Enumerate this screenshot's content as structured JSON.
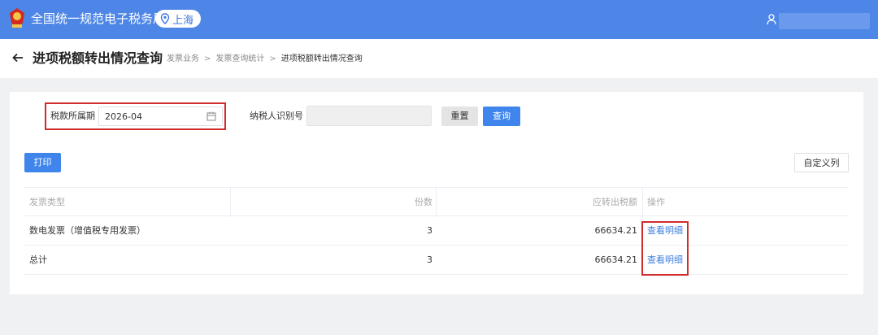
{
  "app": {
    "title": "全国统一规范电子税务局",
    "region": "上海",
    "emblem_color": "#d5281e",
    "accent": "#4d86e6"
  },
  "header": {
    "title": "进项税额转出情况查询",
    "breadcrumb": [
      "发票业务",
      "发票查询统计",
      "进项税额转出情况查询"
    ]
  },
  "filters": {
    "period_label": "税款所属期",
    "period_value": "2026-04",
    "taxid_label": "纳税人识别号",
    "taxid_value": "",
    "reset_label": "重置",
    "query_label": "查询"
  },
  "toolbar": {
    "print_label": "打印",
    "custom_columns_label": "自定义列"
  },
  "table": {
    "columns": [
      "发票类型",
      "份数",
      "应转出税额",
      "操作"
    ],
    "rows": [
      {
        "type": "数电发票（增值税专用发票）",
        "count": "3",
        "amount": "66634.21",
        "action": "查看明细"
      },
      {
        "type": "总计",
        "count": "3",
        "amount": "66634.21",
        "action": "查看明细"
      }
    ]
  },
  "icons": {
    "emblem": "national-emblem-icon",
    "region": "location-pin-icon",
    "user": "user-icon",
    "back": "back-arrow-icon",
    "calendar": "calendar-icon"
  }
}
